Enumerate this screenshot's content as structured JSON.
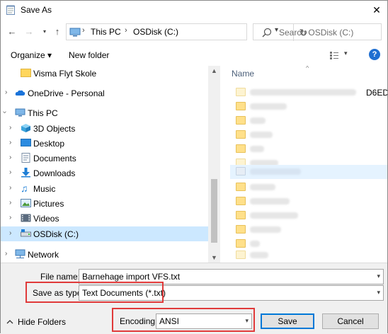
{
  "window": {
    "title": "Save As",
    "close_symbol": "✕"
  },
  "address": {
    "crumbs": [
      "This PC",
      "OSDisk (C:)"
    ],
    "separator": "›"
  },
  "search": {
    "placeholder": "Search OSDisk (C:)"
  },
  "toolbar": {
    "organize": "Organize ▾",
    "new_folder": "New folder",
    "help": "?"
  },
  "tree": {
    "items": [
      {
        "label": "Visma Flyt Skole",
        "icon": "folder-icon"
      },
      {
        "label": "OneDrive - Personal",
        "icon": "cloud-icon"
      },
      {
        "label": "This PC",
        "icon": "computer-icon"
      },
      {
        "label": "3D Objects",
        "icon": "3d-objects-icon"
      },
      {
        "label": "Desktop",
        "icon": "desktop-icon"
      },
      {
        "label": "Documents",
        "icon": "documents-icon"
      },
      {
        "label": "Downloads",
        "icon": "downloads-icon"
      },
      {
        "label": "Music",
        "icon": "music-icon"
      },
      {
        "label": "Pictures",
        "icon": "pictures-icon"
      },
      {
        "label": "Videos",
        "icon": "videos-icon"
      },
      {
        "label": "OSDisk (C:)",
        "icon": "drive-icon"
      },
      {
        "label": "Network",
        "icon": "network-icon"
      }
    ]
  },
  "list": {
    "column_name": "Name",
    "partial_text": "D6ED"
  },
  "footer": {
    "file_name_label": "File name:",
    "file_name_value": "Barnehage import VFS.txt",
    "save_type_label": "Save as type:",
    "save_type_value": "Text Documents (*.txt)",
    "encoding_label": "Encoding:",
    "encoding_value": "ANSI",
    "save_button": "Save",
    "cancel_button": "Cancel",
    "hide_folders": "Hide Folders"
  },
  "colors": {
    "highlight_red": "#e03a3a",
    "selection_blue": "#cce8ff",
    "accent": "#0078d7"
  }
}
